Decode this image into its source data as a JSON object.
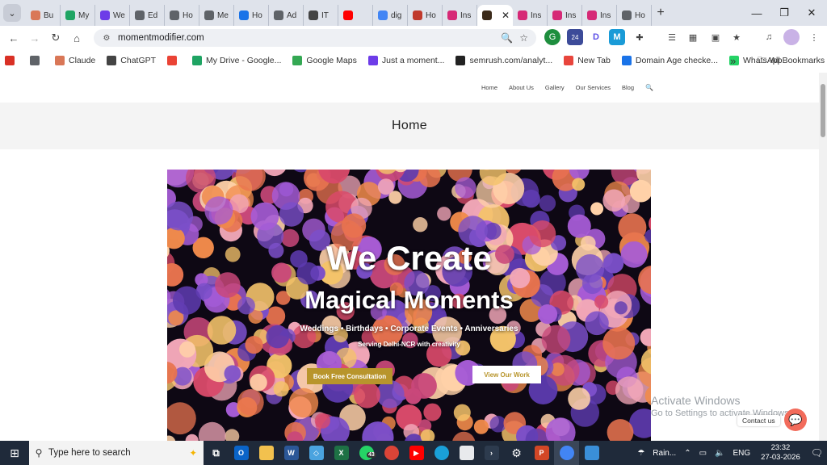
{
  "browser": {
    "tabs": [
      {
        "label": "Bu",
        "icon": "claude-icon",
        "color": "#d97757"
      },
      {
        "label": "My",
        "icon": "google-drive-icon",
        "color": "#1fa463"
      },
      {
        "label": "We",
        "icon": "make-icon",
        "color": "#6d3ce8"
      },
      {
        "label": "Ed",
        "icon": "globe-icon",
        "color": "#5f6368"
      },
      {
        "label": "Ho",
        "icon": "globe-icon",
        "color": "#5f6368"
      },
      {
        "label": "Me",
        "icon": "globe-icon",
        "color": "#5f6368"
      },
      {
        "label": "Ho",
        "icon": "copilot-icon",
        "color": "#1a73e8"
      },
      {
        "label": "Ad",
        "icon": "globe-icon",
        "color": "#5f6368"
      },
      {
        "label": "IT",
        "icon": "chatgpt-icon",
        "color": "#444444"
      },
      {
        "label": "",
        "icon": "youtube-icon",
        "color": "#ff0000"
      },
      {
        "label": "dig",
        "icon": "google-icon",
        "color": "#4285f4"
      },
      {
        "label": "Ho",
        "icon": "site-icon",
        "color": "#c0392b"
      },
      {
        "label": "Ins",
        "icon": "instagram-icon",
        "color": "#d62976"
      },
      {
        "label": "",
        "icon": "moment-icon",
        "color": "#3b2a1a",
        "active": true
      },
      {
        "label": "Ins",
        "icon": "instagram-icon",
        "color": "#d62976"
      },
      {
        "label": "Ins",
        "icon": "instagram-icon",
        "color": "#d62976"
      },
      {
        "label": "Ins",
        "icon": "instagram-icon",
        "color": "#d62976"
      },
      {
        "label": "Ho",
        "icon": "key-icon",
        "color": "#5f6368"
      }
    ],
    "new_tab_glyph": "+",
    "close_glyph": "✕",
    "url": "momentmodifier.com",
    "bookmarks": [
      {
        "label": "",
        "icon": "red-square-icon",
        "color": "#d93025"
      },
      {
        "label": "",
        "icon": "apps-grid-icon",
        "color": "#5f6368"
      },
      {
        "label": "Claude",
        "icon": "claude-icon",
        "color": "#d97757"
      },
      {
        "label": "ChatGPT",
        "icon": "chatgpt-icon",
        "color": "#444444"
      },
      {
        "label": "",
        "icon": "gmail-icon",
        "color": "#ea4335"
      },
      {
        "label": "My Drive - Google...",
        "icon": "google-drive-icon",
        "color": "#1fa463"
      },
      {
        "label": "Google Maps",
        "icon": "maps-pin-icon",
        "color": "#34a853"
      },
      {
        "label": "Just a moment...",
        "icon": "make-icon",
        "color": "#6d3ce8"
      },
      {
        "label": "semrush.com/analyt...",
        "icon": "semrush-icon",
        "color": "#222222"
      },
      {
        "label": "New Tab",
        "icon": "flag-icon",
        "color": "#e8453c"
      },
      {
        "label": "Domain Age checke...",
        "icon": "domain-icon",
        "color": "#1a73e8"
      },
      {
        "label": "WhatsApp",
        "icon": "whatsapp-icon",
        "color": "#25d366"
      }
    ],
    "bookmarks_overflow": "»",
    "all_bookmarks": "All Bookmarks",
    "extension_badge": "24"
  },
  "site": {
    "nav": [
      "Home",
      "About Us",
      "Gallery",
      "Our Services",
      "Blog"
    ],
    "page_title": "Home",
    "hero": {
      "line1": "We Create",
      "line2": "Magical Moments",
      "services": "Weddings • Birthdays • Corporate Events • Anniversaries",
      "tagline": "Serving Delhi-NCR with creativity",
      "primary_button": "Book Free Consultation",
      "secondary_button": "View Our Work"
    },
    "contact_label": "Contact us",
    "accent_color": "#b8952c"
  },
  "watermark": {
    "title": "Activate Windows",
    "subtitle": "Go to Settings to activate Windows."
  },
  "taskbar": {
    "search_placeholder": "Type here to search",
    "whatsapp_badge": "43",
    "weather": "Rain...",
    "language": "ENG",
    "time": "23:32",
    "date": "27-03-2026"
  }
}
